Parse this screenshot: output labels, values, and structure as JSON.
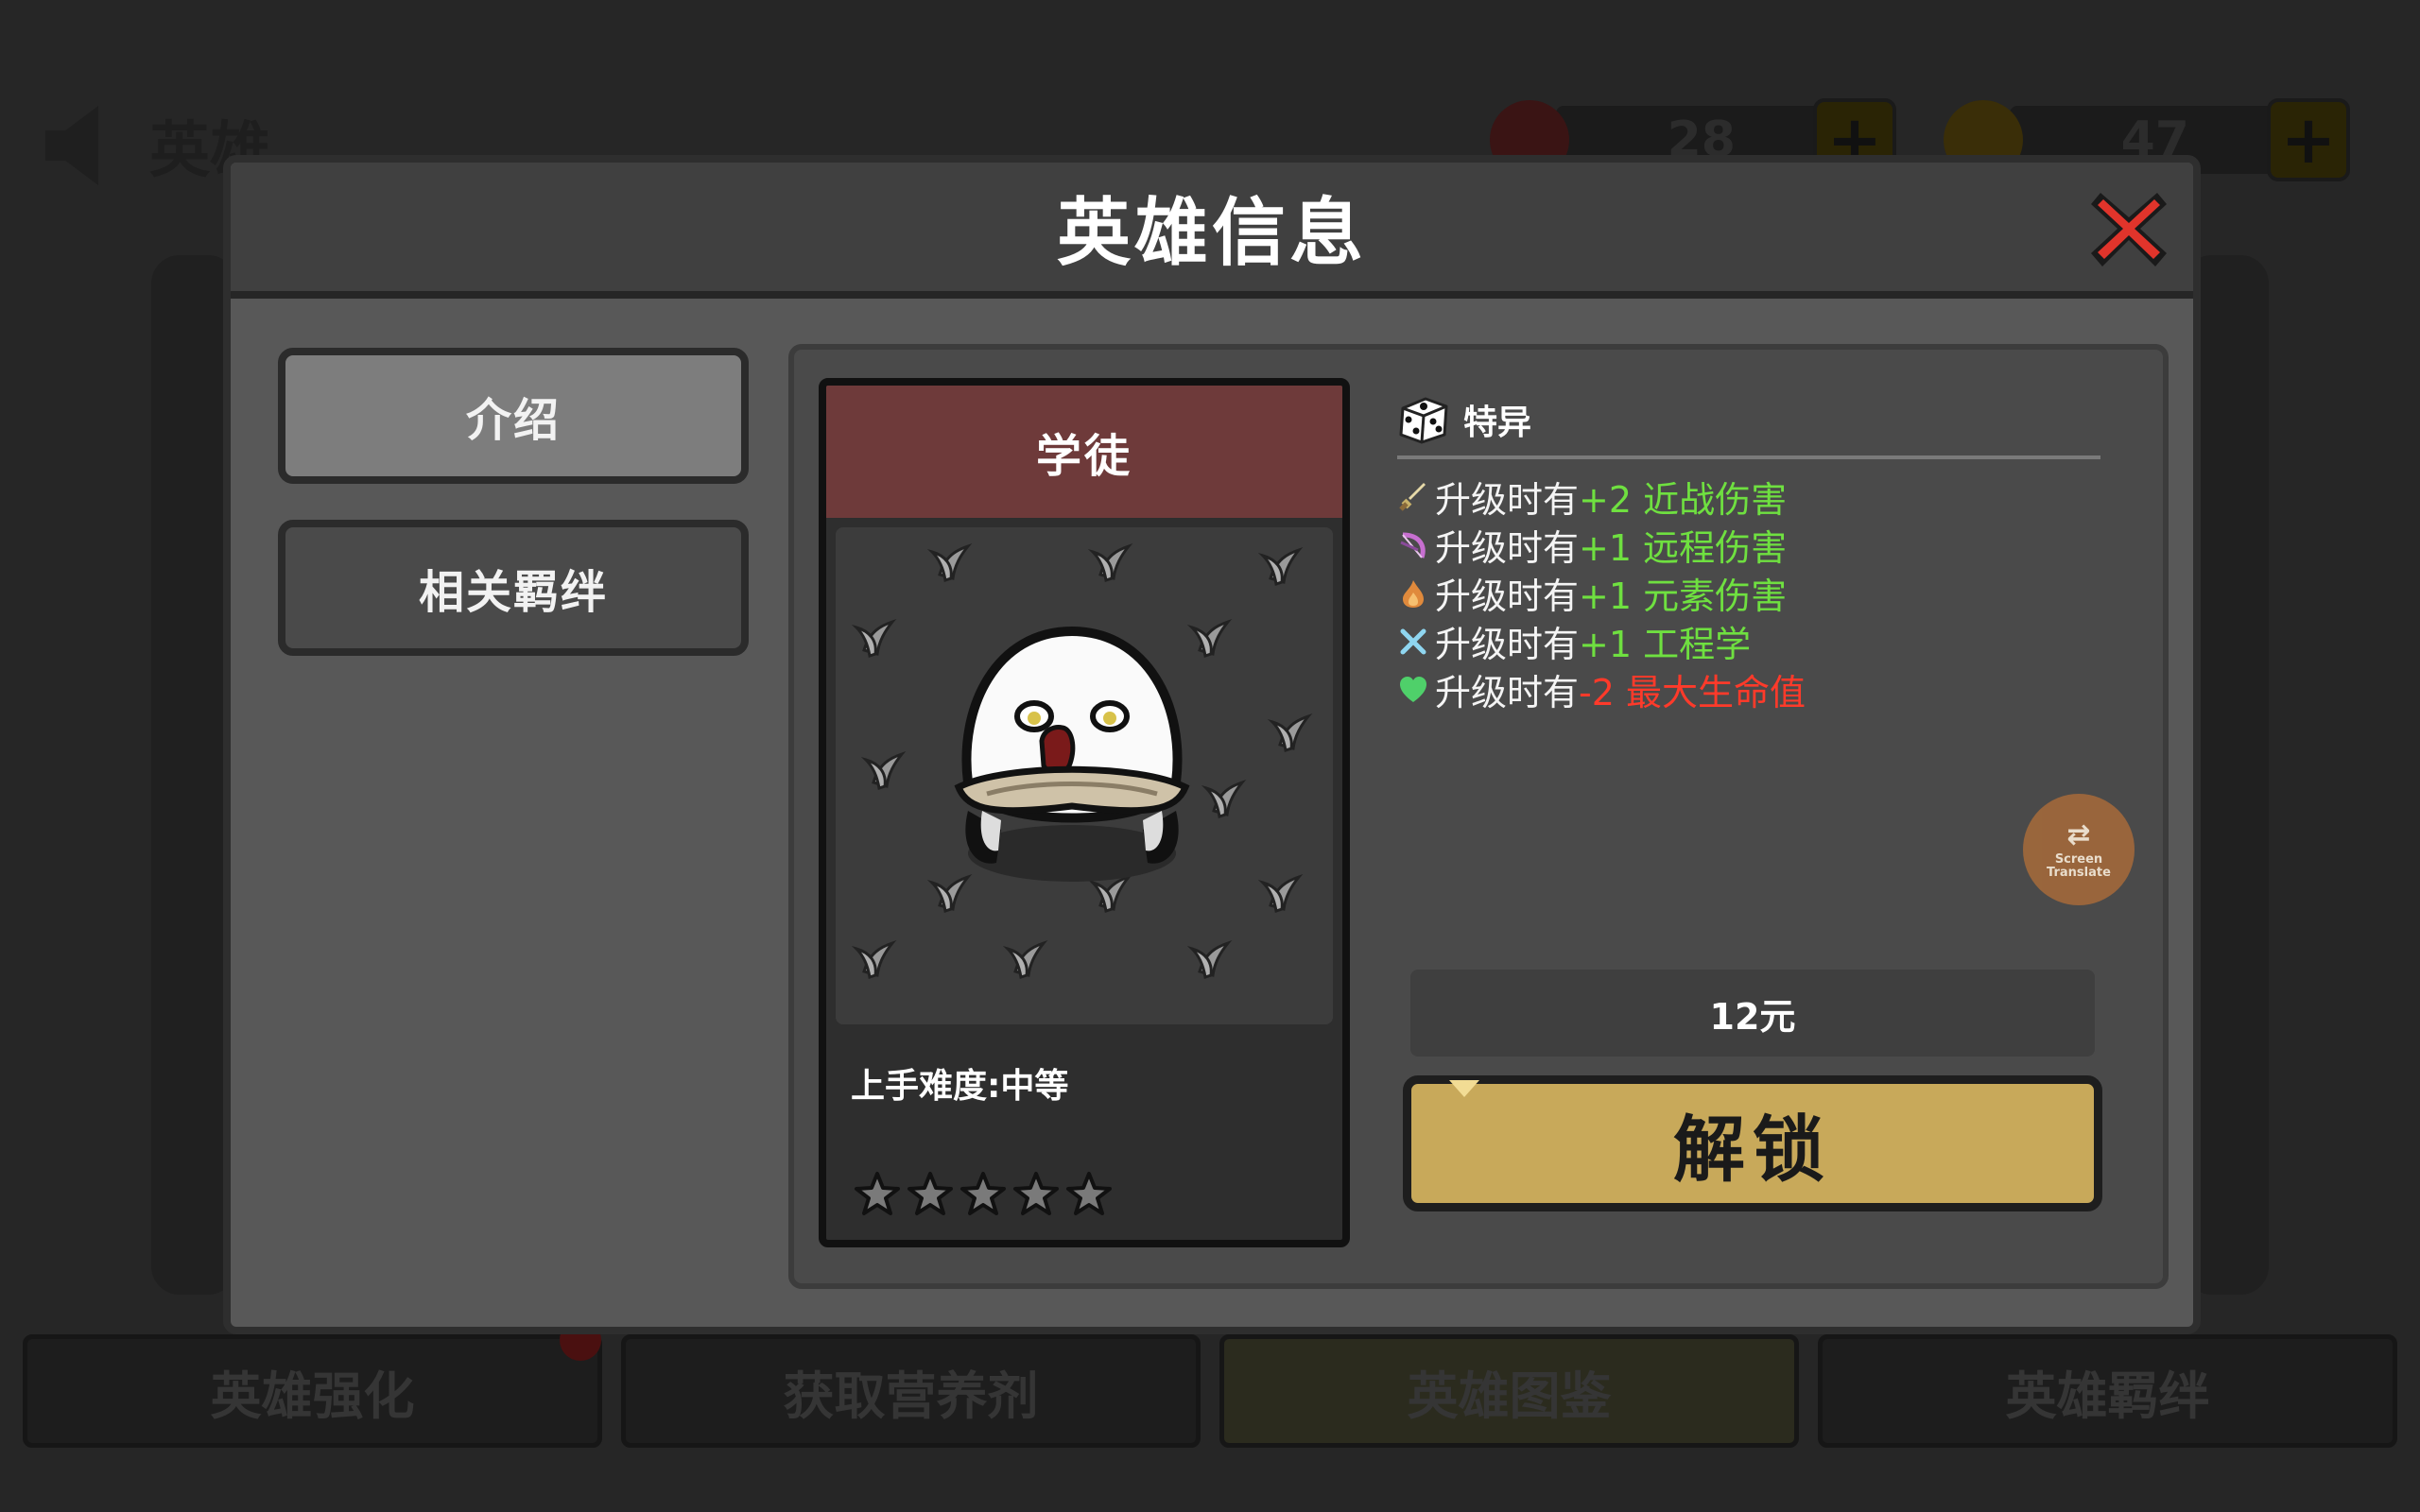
{
  "background": {
    "header_title": "英雄",
    "currency": [
      {
        "icon": "red-gem-icon",
        "value": "28"
      },
      {
        "icon": "gold-coin-icon",
        "value": "47"
      }
    ],
    "bottom_tabs": [
      "英雄强化",
      "获取营养剂",
      "英雄图鉴",
      "英雄羁绊"
    ]
  },
  "modal": {
    "title": "英雄信息",
    "nav": {
      "intro_label": "介绍",
      "bonds_label": "相关羁绊"
    },
    "hero": {
      "name": "学徒",
      "difficulty": "上手难度:中等",
      "stars_filled": 0,
      "stars_total": 5
    },
    "trait": {
      "title": "特异",
      "icon": "dice-icon",
      "lines": [
        {
          "icon": "sword-icon",
          "prefix": "升级时有",
          "value": "+2 近战伤害",
          "color": "green"
        },
        {
          "icon": "bow-icon",
          "prefix": "升级时有",
          "value": "+1 远程伤害",
          "color": "green"
        },
        {
          "icon": "flame-icon",
          "prefix": "升级时有",
          "value": "+1 元素伤害",
          "color": "green"
        },
        {
          "icon": "wrench-cross-icon",
          "prefix": "升级时有",
          "value": "+1 工程学",
          "color": "green"
        },
        {
          "icon": "heart-icon",
          "prefix": "升级时有",
          "value": "-2 最大生命值",
          "color": "red"
        }
      ]
    },
    "translate_badge": {
      "line1": "Screen",
      "line2": "Translate"
    },
    "price": "12元",
    "unlock_label": "解锁"
  },
  "colors": {
    "positive": "#6fe040",
    "negative": "#ff3a2a",
    "unlock_button": "#c8a95a",
    "hero_name_bar": "#6e3a3a"
  }
}
